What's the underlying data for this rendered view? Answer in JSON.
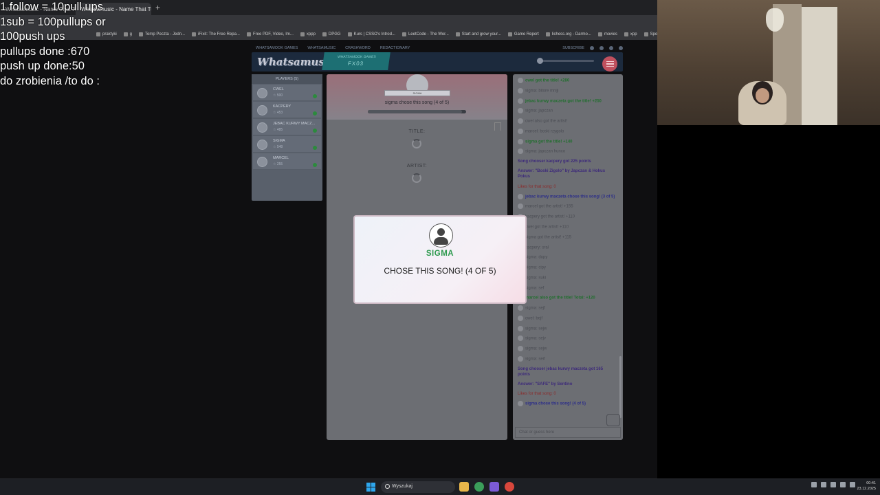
{
  "browser": {
    "tabs": [
      {
        "label": "Whatsamusic - Name That Tu...",
        "active": false
      },
      {
        "label": "Whatsamusic - Name That Tu...",
        "active": true
      }
    ],
    "bookmarks": [
      "praktyki",
      "g",
      "Temp Poczta - Jedn...",
      "iFixit: The Free Repa...",
      "Free PDF, Video, Im...",
      "xppp",
      "DPGG",
      "Kurs | CSSO's Introd...",
      "LeetCode - The Wor...",
      "Start and grow your...",
      "Game Report",
      "lichess.org - Darmo...",
      "movies",
      "xpp",
      "Społeczność Ste..."
    ]
  },
  "overlay": {
    "lines": [
      "1 follow = 10pull ups",
      "1sub = 100pullups or",
      "100push ups",
      "pullups done :670",
      "push up done:50",
      "do zrobienia /to do :"
    ]
  },
  "site": {
    "nav": [
      "WHATSAMOOK GAMES",
      "WHATSAMUSIC",
      "CRASHWORD",
      "REDACTIONARY"
    ],
    "subscribe": "SUBSCRIBE",
    "logo": "Whatsamusic",
    "badge_top": "WHATSAMOOK GAMES",
    "badge_bottom": "FX03"
  },
  "players": {
    "header": "PLAYERS (5)",
    "list": [
      {
        "name": "CWEL",
        "points": "500"
      },
      {
        "name": "KACPERY",
        "points": "453"
      },
      {
        "name": "JEBAC KURWY MACZ...",
        "points": "485"
      },
      {
        "name": "SIGMA",
        "points": "548"
      },
      {
        "name": "MARCEL",
        "points": "255"
      }
    ]
  },
  "stage": {
    "chooser_name": "SIGMA",
    "chose_text": "sigma chose this song (4 of 5)",
    "progress": 0.96,
    "title_label": "TITLE:",
    "artist_label": "ARTIST:"
  },
  "chat": {
    "messages": [
      {
        "cls": "green",
        "text": "cwel got the title! +280",
        "avatar": true
      },
      {
        "cls": "gray",
        "text": "sigma: bitore mniji",
        "avatar": true
      },
      {
        "cls": "green wrap",
        "text": "jebac kurwy maczeta got the title! +250",
        "avatar": true
      },
      {
        "cls": "gray",
        "text": "sigma: japczan",
        "avatar": true
      },
      {
        "cls": "gray",
        "text": "cwel also got the artist!",
        "avatar": true
      },
      {
        "cls": "gray",
        "text": "marcel: boski rzygolo",
        "avatar": true
      },
      {
        "cls": "green",
        "text": "sigma got the title! +140",
        "avatar": true
      },
      {
        "cls": "gray",
        "text": "sigma: japczan hunco",
        "avatar": true
      },
      {
        "cls": "purple",
        "text": "Song chooser kacpery got 225 points",
        "avatar": false
      },
      {
        "cls": "purple wrap",
        "text": "Answer: \"Boski Żigolo\" by Japczan & Hokus Pokus",
        "avatar": false
      },
      {
        "cls": "red",
        "text": "Likes for that song: 0",
        "avatar": false
      },
      {
        "cls": "blue wrap",
        "text": "jebac kurwy maczeta chose this song! (3 of 5)",
        "avatar": true
      },
      {
        "cls": "gray",
        "text": "marcel got the artist! +155",
        "avatar": true
      },
      {
        "cls": "gray",
        "text": "kacpery got the artist! +110",
        "avatar": true
      },
      {
        "cls": "gray",
        "text": "cwel got the artist! +110",
        "avatar": true
      },
      {
        "cls": "gray",
        "text": "sigma got the artist! +115",
        "avatar": true
      },
      {
        "cls": "gray",
        "text": "kacpery: srał",
        "avatar": true
      },
      {
        "cls": "gray",
        "text": "sigma: dupy",
        "avatar": true
      },
      {
        "cls": "gray",
        "text": "sigma: cipy",
        "avatar": true
      },
      {
        "cls": "gray",
        "text": "sigma: suki",
        "avatar": true
      },
      {
        "cls": "gray",
        "text": "sigma: sef",
        "avatar": true
      },
      {
        "cls": "green",
        "text": "marcel also got the title! Total: +120",
        "avatar": true
      },
      {
        "cls": "gray",
        "text": "sigma: sejf",
        "avatar": true
      },
      {
        "cls": "gray",
        "text": "cwel: bejf",
        "avatar": true
      },
      {
        "cls": "gray",
        "text": "sigma: sejw",
        "avatar": true
      },
      {
        "cls": "gray",
        "text": "sigma: sejv",
        "avatar": true
      },
      {
        "cls": "gray",
        "text": "sigma: sejw",
        "avatar": true
      },
      {
        "cls": "gray",
        "text": "sigma: seif",
        "avatar": true
      },
      {
        "cls": "purple wrap",
        "text": "Song chooser jebac kurwy maczeta got 165 points",
        "avatar": false
      },
      {
        "cls": "purple",
        "text": "Answer: \"SAFE\" by Sentino",
        "avatar": false
      },
      {
        "cls": "red",
        "text": "Likes for that song: 0",
        "avatar": false
      },
      {
        "cls": "blue",
        "text": "sigma chose this song! (4 of 5)",
        "avatar": true
      }
    ],
    "input_placeholder": "Chat or guess here"
  },
  "modal": {
    "name": "SIGMA",
    "text": "CHOSE THIS SONG! (4 OF 5)"
  },
  "taskbar": {
    "search_label": "Wyszukaj",
    "time": "00:41",
    "date": "23.12.2025"
  },
  "colors": {
    "accent_green": "#2f9a4f",
    "menu_red": "#c0505e",
    "header_navy": "#1c2a3d"
  }
}
